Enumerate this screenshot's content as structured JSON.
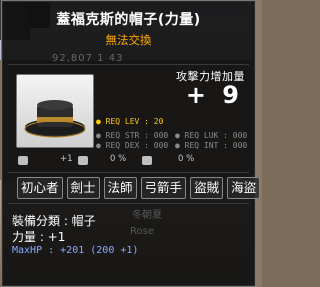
{
  "item": {
    "title": "蓋福克斯的帽子(力量)",
    "trade_status": "無法交換",
    "faint_text": "92,807 1 43"
  },
  "bonus": {
    "label": "攻擊力增加量",
    "value": "+ 9"
  },
  "requirements": {
    "lev": "● REQ LEV :      20",
    "str": "● REQ STR : 000",
    "dex": "● REQ DEX : 000",
    "luk": "● REQ LUK : 000",
    "int": "● REQ INT : 000"
  },
  "icon_row": {
    "a": "+1",
    "b": "0 %",
    "c": "0 %"
  },
  "jobs": [
    "初心者",
    "劍士",
    "法師",
    "弓箭手",
    "盜賊",
    "海盜"
  ],
  "background_text": {
    "name": "冬朝夏",
    "sub": "Rose"
  },
  "stats": {
    "category_label": "裝備分類 : 帽子",
    "str_label": "力量 : +1",
    "maxhp_label": "MaxHP : +201 (200 +1)"
  },
  "colors": {
    "title": "#ffffff",
    "trade_status": "#ffaa00",
    "req_lev": "#ffcc00",
    "maxhp": "#88aaff"
  }
}
